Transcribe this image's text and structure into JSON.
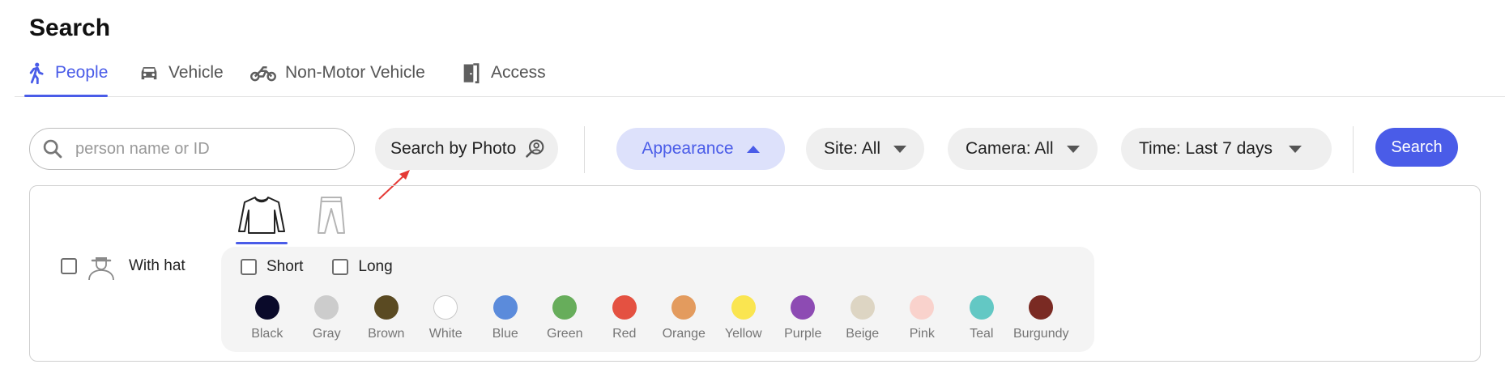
{
  "page": {
    "title": "Search"
  },
  "tabs": [
    {
      "label": "People",
      "icon": "person-walking-icon",
      "active": true
    },
    {
      "label": "Vehicle",
      "icon": "car-icon",
      "active": false
    },
    {
      "label": "Non-Motor Vehicle",
      "icon": "motorcycle-icon",
      "active": false
    },
    {
      "label": "Access",
      "icon": "door-icon",
      "active": false
    }
  ],
  "search": {
    "placeholder": "person name or ID",
    "value": ""
  },
  "filters": {
    "photo": "Search by Photo",
    "appearance": "Appearance",
    "site": "Site: All",
    "camera": "Camera: All",
    "time": "Time: Last 7 days",
    "search_button": "Search"
  },
  "appearance_panel": {
    "hat_label": "With hat",
    "length_options": [
      "Short",
      "Long"
    ],
    "colors": [
      {
        "name": "Black",
        "hex": "#0a0a2a"
      },
      {
        "name": "Gray",
        "hex": "#cccccc"
      },
      {
        "name": "Brown",
        "hex": "#5a4a22"
      },
      {
        "name": "White",
        "hex": "#ffffff"
      },
      {
        "name": "Blue",
        "hex": "#5b8bdb"
      },
      {
        "name": "Green",
        "hex": "#67ad5b"
      },
      {
        "name": "Red",
        "hex": "#e45141"
      },
      {
        "name": "Orange",
        "hex": "#e39b5e"
      },
      {
        "name": "Yellow",
        "hex": "#fae550"
      },
      {
        "name": "Purple",
        "hex": "#8d4bb3"
      },
      {
        "name": "Beige",
        "hex": "#ddd5c3"
      },
      {
        "name": "Pink",
        "hex": "#f9d2cc"
      },
      {
        "name": "Teal",
        "hex": "#63c8c4"
      },
      {
        "name": "Burgundy",
        "hex": "#7a2a23"
      }
    ]
  },
  "colors": {
    "accent": "#4a5ce8",
    "accent_light": "#dde1fb",
    "annotation_arrow": "#e53935"
  }
}
